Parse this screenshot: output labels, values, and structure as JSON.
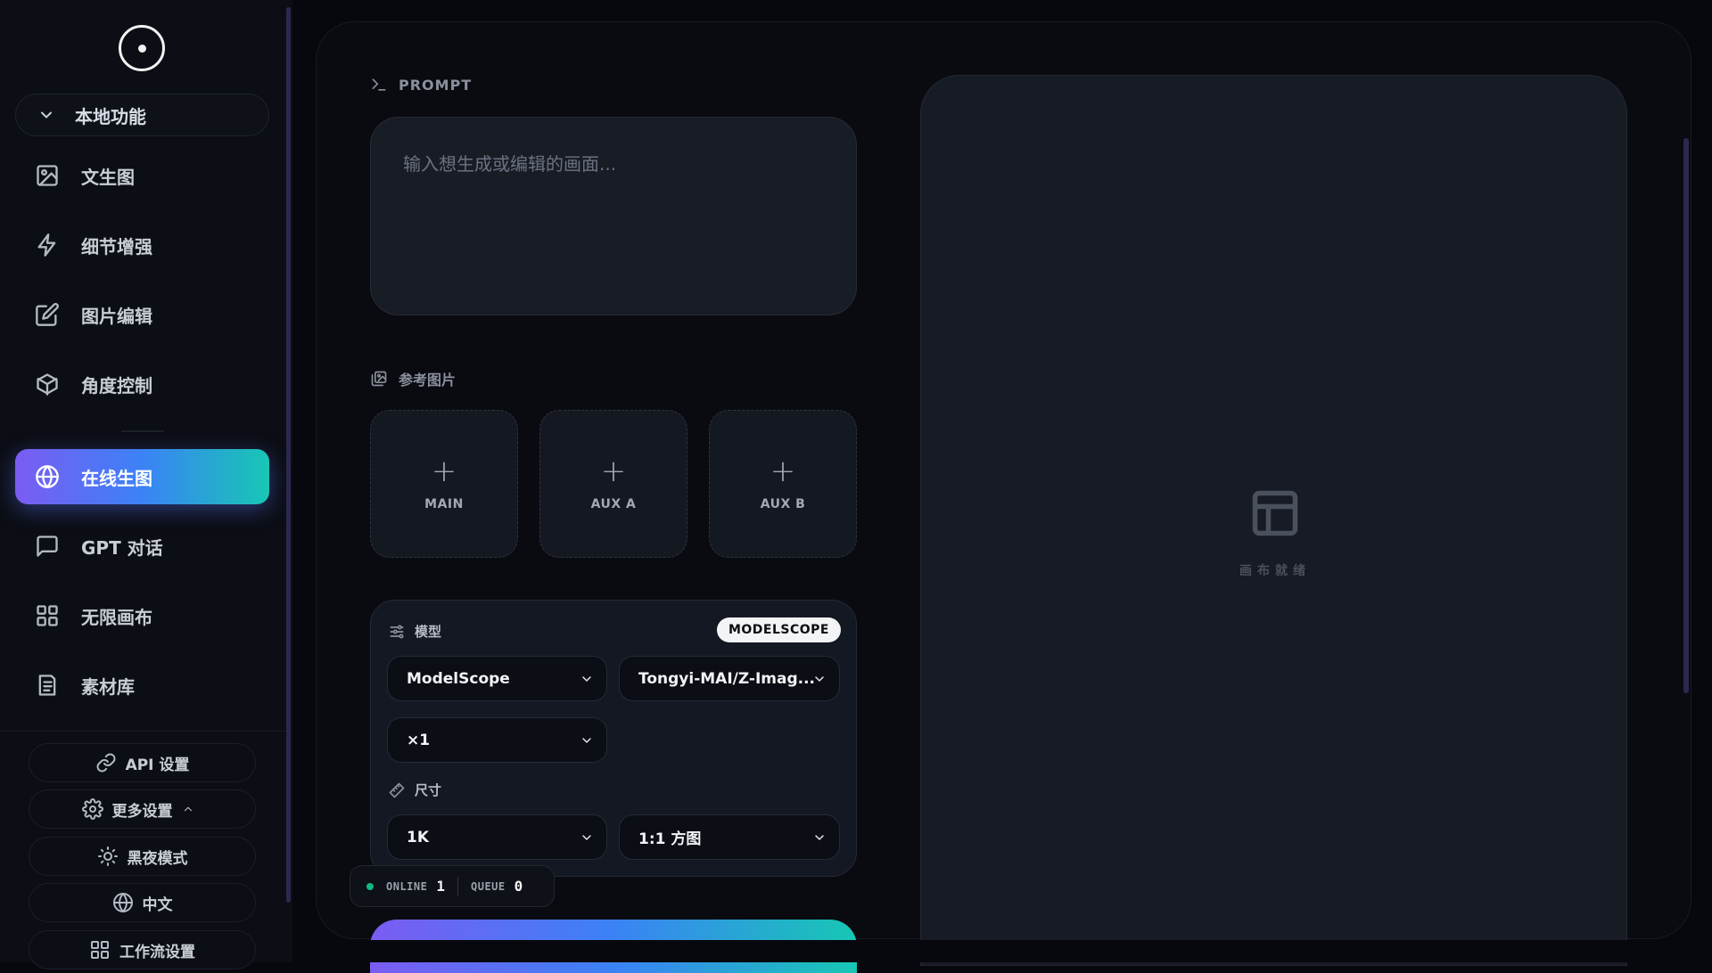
{
  "sidebar": {
    "group_label": "本地功能",
    "items": [
      {
        "label": "文生图",
        "icon": "image-icon"
      },
      {
        "label": "细节增强",
        "icon": "zap-icon"
      },
      {
        "label": "图片编辑",
        "icon": "edit-icon"
      },
      {
        "label": "角度控制",
        "icon": "cube-icon"
      },
      {
        "label": "在线生图",
        "icon": "globe-icon",
        "active": true
      },
      {
        "label": "GPT 对话",
        "icon": "chat-icon"
      },
      {
        "label": "无限画布",
        "icon": "grid-icon"
      },
      {
        "label": "素材库",
        "icon": "library-icon"
      }
    ],
    "footer": {
      "api_settings": "API 设置",
      "more_settings": "更多设置",
      "dark_mode": "黑夜模式",
      "language": "中文",
      "workflow_settings": "工作流设置"
    }
  },
  "prompt": {
    "title": "PROMPT",
    "placeholder": "输入想生成或编辑的画面..."
  },
  "reference": {
    "title": "参考图片",
    "slots": [
      "MAIN",
      "AUX A",
      "AUX B"
    ]
  },
  "model": {
    "title": "模型",
    "badge": "MODELSCOPE",
    "provider": "ModelScope",
    "model_name": "Tongyi-MAI/Z-Imag...",
    "count": "×1",
    "size_title": "尺寸",
    "resolution": "1K",
    "aspect": "1:1 方图"
  },
  "status": {
    "online_label": "ONLINE",
    "online_value": "1",
    "queue_label": "QUEUE",
    "queue_value": "0"
  },
  "canvas": {
    "empty_text": "画布就绪"
  },
  "colors": {
    "accent_start": "#7b5cf2",
    "accent_mid": "#3b82f6",
    "accent_end": "#17c7b4",
    "online_dot": "#10b981"
  }
}
